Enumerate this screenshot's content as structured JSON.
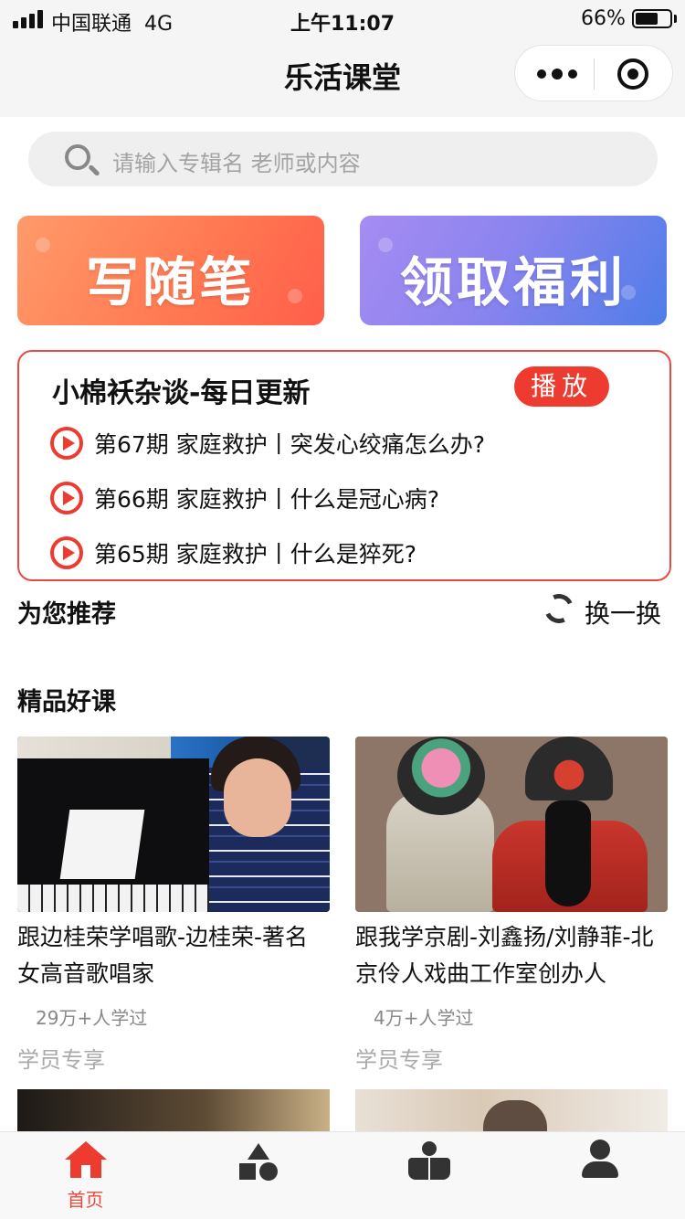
{
  "status_bar": {
    "carrier": "中国联通",
    "network": "4G",
    "time": "上午11:07",
    "battery_pct": "66%",
    "battery_level": 0.66
  },
  "nav": {
    "title": "乐活课堂"
  },
  "search": {
    "placeholder": "请输入专辑名 老师或内容"
  },
  "banners": [
    {
      "label": "写随笔",
      "color": "#ff7a52"
    },
    {
      "label": "领取福利",
      "color": "#8c84ef"
    }
  ],
  "podcast": {
    "title": "小棉袄杂谈-每日更新",
    "play_label": "播放",
    "episodes": [
      {
        "text": "第67期 家庭救护丨突发心绞痛怎么办?"
      },
      {
        "text": "第66期 家庭救护丨什么是冠心病?"
      },
      {
        "text": "第65期 家庭救护丨什么是猝死?"
      }
    ]
  },
  "recommend": {
    "title": "为您推荐",
    "refresh_label": "换一换"
  },
  "premium": {
    "title": "精品好课",
    "courses": [
      {
        "title": "跟边桂荣学唱歌-边桂荣-著名女高音歌唱家",
        "count": "29万+人学过",
        "tag": "学员专享"
      },
      {
        "title": "跟我学京剧-刘鑫扬/刘静菲-北京伶人戏曲工作室创办人",
        "count": "4万+人学过",
        "tag": "学员专享"
      }
    ]
  },
  "tabbar": {
    "home_label": "首页",
    "active_color": "#e84a3e",
    "icons": [
      "home-icon",
      "shapes-icon",
      "reader-icon",
      "user-icon"
    ]
  },
  "colors": {
    "accent": "#ee3b30",
    "card_border": "#e84a3e"
  }
}
